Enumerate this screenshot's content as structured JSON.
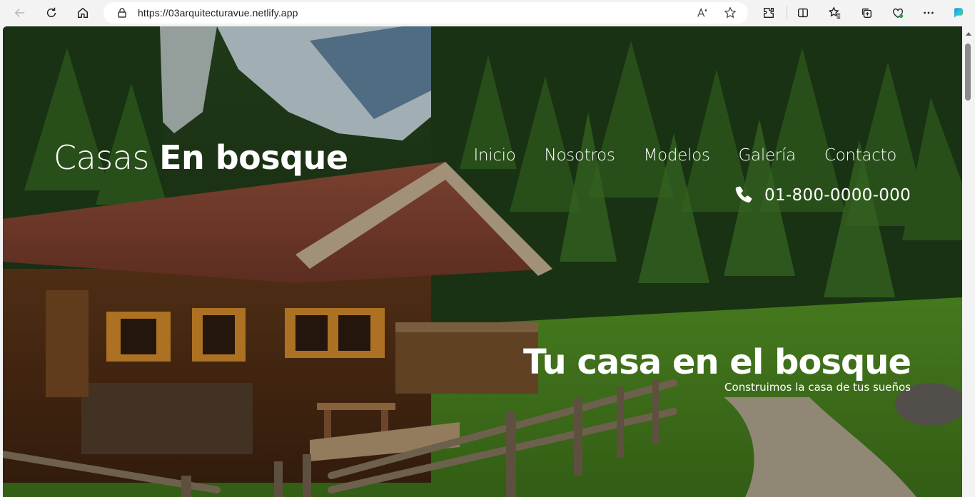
{
  "browser": {
    "url": "https://03arquitecturavue.netlify.app",
    "icons": [
      "back-icon",
      "refresh-icon",
      "home-icon",
      "lock-icon",
      "read-aloud-icon",
      "favorite-star-icon",
      "extensions-icon",
      "split-screen-icon",
      "favorites-icon",
      "collections-icon",
      "browser-essentials-icon",
      "more-icon",
      "copilot-icon"
    ]
  },
  "page": {
    "logo": {
      "light": "Casas",
      "bold": "En bosque"
    },
    "nav": [
      "Inicio",
      "Nosotros",
      "Modelos",
      "Galería",
      "Contacto"
    ],
    "phone": {
      "icon": "phone-icon",
      "number": "01-800-0000-000"
    },
    "hero": {
      "title": "Tu casa en el bosque",
      "subtitle": "Construimos la casa de tus sueños"
    }
  },
  "colors": {
    "text": "#ffffff",
    "chrome": "#f3f3f3"
  }
}
